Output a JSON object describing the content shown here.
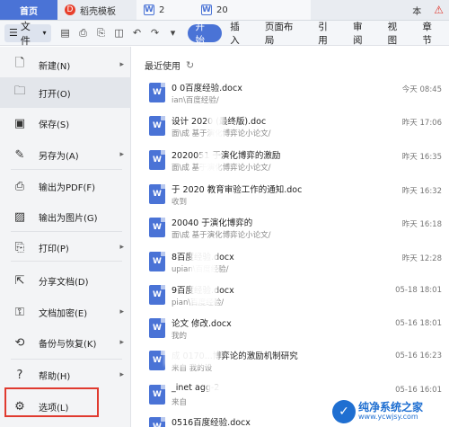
{
  "tabs": [
    {
      "label": "首页"
    },
    {
      "label": "稻壳模板"
    },
    {
      "label": "2"
    },
    {
      "label": "20"
    },
    {
      "label": "本"
    }
  ],
  "toolbar": {
    "file_label": "文件",
    "ribbon": [
      "开始",
      "插入",
      "页面布局",
      "引用",
      "审阅",
      "视图",
      "章节"
    ]
  },
  "menu": [
    {
      "label": "新建(N)",
      "icon": "new-document-icon",
      "arrow": true
    },
    {
      "label": "打开(O)",
      "icon": "folder-open-icon",
      "arrow": false
    },
    {
      "label": "保存(S)",
      "icon": "save-icon",
      "arrow": false
    },
    {
      "label": "另存为(A)",
      "icon": "save-as-icon",
      "arrow": true
    },
    {
      "label": "输出为PDF(F)",
      "icon": "pdf-export-icon",
      "arrow": false
    },
    {
      "label": "输出为图片(G)",
      "icon": "image-export-icon",
      "arrow": false
    },
    {
      "label": "打印(P)",
      "icon": "printer-icon",
      "arrow": true
    },
    {
      "label": "分享文档(D)",
      "icon": "share-icon",
      "arrow": false
    },
    {
      "label": "文档加密(E)",
      "icon": "lock-icon",
      "arrow": true
    },
    {
      "label": "备份与恢复(K)",
      "icon": "backup-icon",
      "arrow": true
    },
    {
      "label": "帮助(H)",
      "icon": "help-icon",
      "arrow": true
    },
    {
      "label": "选项(L)",
      "icon": "gear-icon",
      "arrow": false
    }
  ],
  "recent": {
    "title": "最近使用",
    "files": [
      {
        "name": "0  0百度经验.docx",
        "path": "    ian\\百度经验/",
        "time": "今天 08:45"
      },
      {
        "name": "设计    2020    (最终版).doc",
        "path": "   面\\成    基于演化博弈论小论文/",
        "time": "昨天 17:06"
      },
      {
        "name": "2020051    于演化博弈的激励",
        "path": "   面\\成   基于演化博弈论小论文/",
        "time": "昨天 16:35"
      },
      {
        "name": "于    2020    教育审验工作的通知.doc",
        "path": "    收到    ",
        "time": "昨天 16:32"
      },
      {
        "name": "20040    于演化博弈的",
        "path": "   面\\成   基于演化博弈论小论文/",
        "time": "昨天 16:18"
      },
      {
        "name": "   8百度经验.docx",
        "path": "upian\\百度经验/",
        "time": "昨天 12:28"
      },
      {
        "name": "   9百度经验.docx",
        "path": "   pian\\百度经验/",
        "time": "05-18 18:01"
      },
      {
        "name": "   论文    修改.docx",
        "path": "    我的   ",
        "time": "05-16 18:01"
      },
      {
        "name": "     成    0170...博弈论的激励机制研究",
        "path": "来自    我的设",
        "time": "05-16 16:23"
      },
      {
        "name": "_inet    agg-2",
        "path": "来自    ",
        "time": "05-16 16:01"
      },
      {
        "name": "0516百度经验.docx",
        "path": "",
        "time": ""
      }
    ]
  },
  "watermark": {
    "title": "纯净系统之家",
    "url": "www.ycwjsy.com"
  }
}
